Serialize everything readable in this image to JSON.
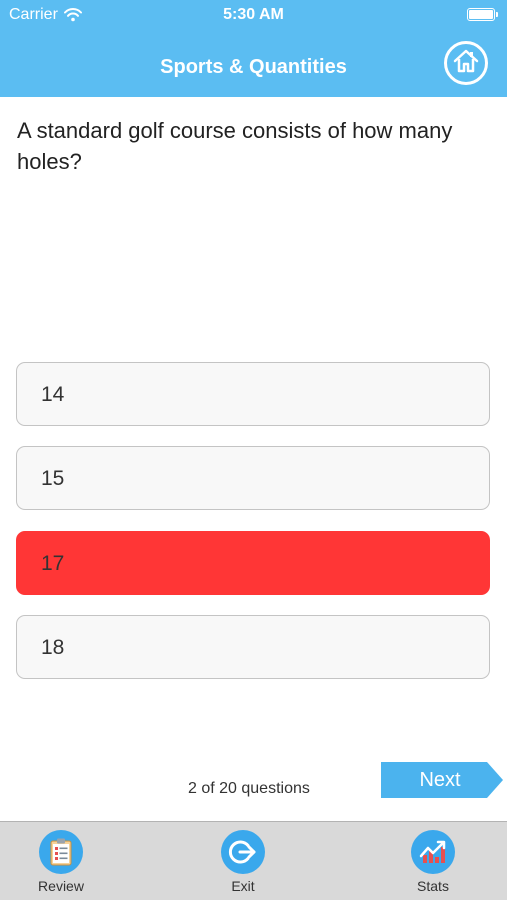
{
  "status_bar": {
    "carrier": "Carrier",
    "time": "5:30 AM",
    "icons": [
      "wifi-icon",
      "battery-icon"
    ]
  },
  "nav": {
    "title": "Sports & Quantities",
    "home_icon": "home-icon"
  },
  "question": {
    "text": "A standard golf course consists of how many holes?"
  },
  "answers": [
    {
      "label": "14",
      "state": "default"
    },
    {
      "label": "15",
      "state": "default"
    },
    {
      "label": "17",
      "state": "wrong"
    },
    {
      "label": "18",
      "state": "default"
    }
  ],
  "progress": {
    "text": "2 of 20 questions",
    "current": 2,
    "total": 20
  },
  "next_button": {
    "label": "Next"
  },
  "tab_bar": {
    "items": [
      {
        "label": "Review",
        "icon": "clipboard-icon"
      },
      {
        "label": "Exit",
        "icon": "exit-icon"
      },
      {
        "label": "Stats",
        "icon": "stats-chart-icon"
      }
    ]
  },
  "colors": {
    "header": "#5bbdf2",
    "wrong_answer": "#ff3636",
    "tab_icon": "#3aa8ec",
    "next_button": "#4bb3ee",
    "tab_bar": "#d9d9d9"
  }
}
